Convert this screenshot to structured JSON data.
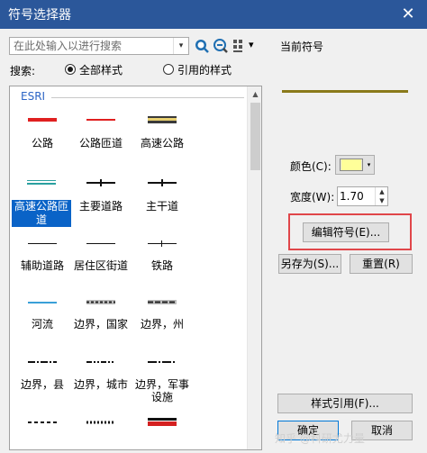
{
  "window": {
    "title": "符号选择器",
    "close_glyph": "✕"
  },
  "search": {
    "placeholder": "在此处输入以进行搜索",
    "dropdown_glyph": "▾"
  },
  "toolbar": {
    "search_icon": "search-icon",
    "zoom_icon": "zoom-icon",
    "view_icon": "grid-view-icon",
    "view_dropdown_glyph": "▾"
  },
  "scope": {
    "label": "搜索:",
    "options": [
      {
        "label": "全部样式",
        "selected": true
      },
      {
        "label": "引用的样式",
        "selected": false
      }
    ]
  },
  "gallery": {
    "group": "ESRI",
    "items": [
      {
        "label": "公路",
        "style": "red-thick"
      },
      {
        "label": "公路匝道",
        "style": "red-thin"
      },
      {
        "label": "高速公路",
        "style": "highway"
      },
      {
        "label": "高速公路匝道",
        "style": "teal-double",
        "selected": true
      },
      {
        "label": "主要道路",
        "style": "black-ticks"
      },
      {
        "label": "主干道",
        "style": "black-ticks"
      },
      {
        "label": "辅助道路",
        "style": "black"
      },
      {
        "label": "居住区街道",
        "style": "black"
      },
      {
        "label": "铁路",
        "style": "railroad"
      },
      {
        "label": "河流",
        "style": "blue"
      },
      {
        "label": "边界，国家",
        "style": "gray-dash"
      },
      {
        "label": "边界，州",
        "style": "gray-dash"
      },
      {
        "label": "边界，县",
        "style": "dashdot"
      },
      {
        "label": "边界，城市",
        "style": "dashdot-dots"
      },
      {
        "label": "边界，军事设施",
        "style": "dashdot-long"
      },
      {
        "label": "",
        "style": "black-dash"
      },
      {
        "label": "",
        "style": "black-dash-bold"
      },
      {
        "label": "",
        "style": "red-black"
      }
    ]
  },
  "current_symbol": {
    "label": "当前符号",
    "preview_color": "#8a7a1a",
    "color_label": "颜色(C):",
    "color_value": "#ffff99",
    "color_dropdown_glyph": "▾",
    "width_label": "宽度(W):",
    "width_value": "1.70",
    "spin_up_glyph": "▲",
    "spin_down_glyph": "▼"
  },
  "buttons": {
    "edit": "编辑符号(E)...",
    "save_as": "另存为(S)...",
    "reset": "重置(R)",
    "style_references": "样式引用(F)...",
    "ok": "确定",
    "cancel": "取消"
  },
  "watermark": "知乎 @科研尤力量",
  "colors": {
    "title_bar": "#2b579a",
    "selection": "#0a63c7",
    "highlight": "#e0464a",
    "group_label": "#2b64c5"
  }
}
